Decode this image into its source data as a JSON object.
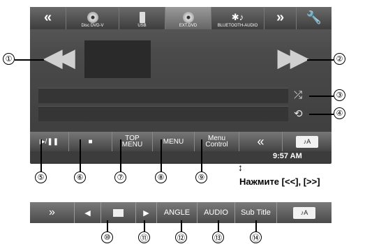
{
  "topbar": {
    "prev_label": "«",
    "sources": [
      {
        "label": "Disc DVD-V"
      },
      {
        "label": "USB"
      },
      {
        "label": "EXT.DVD"
      },
      {
        "label": "BLUETOOTH-AUDIO"
      }
    ],
    "next_label": "»"
  },
  "player": {
    "prev_glyph": "◀◀",
    "next_glyph": "▶▶"
  },
  "controls": {
    "play_pause": "▶/❚❚",
    "stop": "■",
    "top_menu": "TOP MENU",
    "menu": "MENU",
    "menu_control": "Menu Control",
    "back": "«",
    "source_badge": "♪A"
  },
  "clock": "9:57 AM",
  "press_note": "Нажмите [<<], [>>]",
  "bar2": {
    "forward": "»",
    "prev": "◀",
    "next": "▶",
    "angle": "ANGLE",
    "audio": "AUDIO",
    "subtitle": "Sub Title",
    "source_badge": "♪A"
  },
  "callouts": [
    "①",
    "②",
    "③",
    "④",
    "⑤",
    "⑥",
    "⑦",
    "⑧",
    "⑨",
    "⑩",
    "⑪",
    "⑫",
    "⑬",
    "⑭"
  ]
}
